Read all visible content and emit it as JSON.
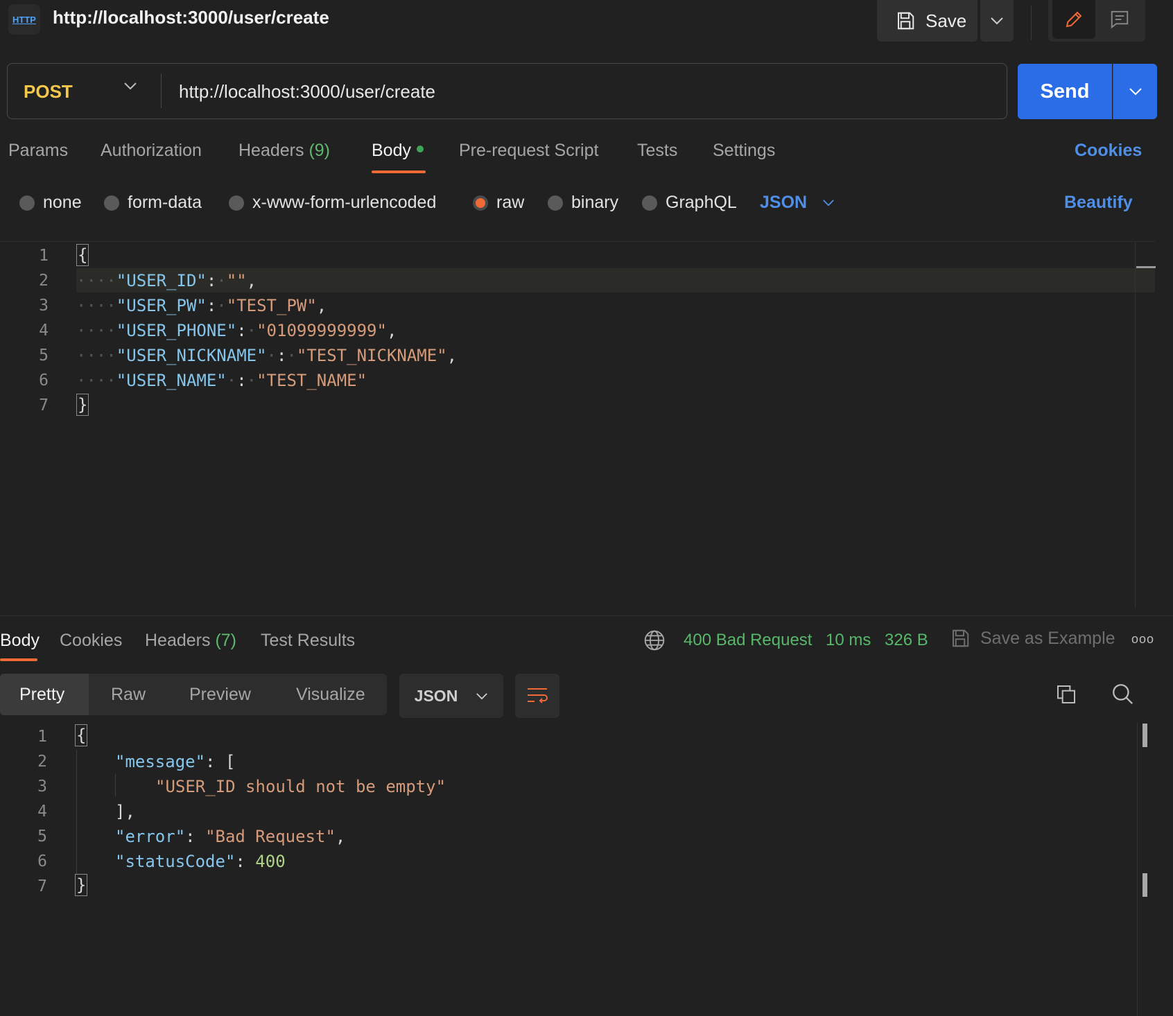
{
  "header": {
    "icon_label": "HTTP",
    "title": "http://localhost:3000/user/create",
    "save_label": "Save"
  },
  "request": {
    "method": "POST",
    "url": "http://localhost:3000/user/create",
    "send_label": "Send"
  },
  "request_tabs": {
    "params": "Params",
    "authorization": "Authorization",
    "headers": "Headers",
    "headers_count": "(9)",
    "body": "Body",
    "pre_request": "Pre-request Script",
    "tests": "Tests",
    "settings": "Settings",
    "cookies": "Cookies"
  },
  "body_types": {
    "none": "none",
    "form_data": "form-data",
    "urlencoded": "x-www-form-urlencoded",
    "raw": "raw",
    "binary": "binary",
    "graphql": "GraphQL",
    "selected_language": "JSON",
    "beautify": "Beautify"
  },
  "request_body": {
    "line_numbers": [
      "1",
      "2",
      "3",
      "4",
      "5",
      "6",
      "7"
    ],
    "open_brace": "{",
    "close_brace": "}",
    "entries": [
      {
        "key": "\"USER_ID\"",
        "sep": ":",
        "value": "\"\"",
        "trail": ","
      },
      {
        "key": "\"USER_PW\"",
        "sep": ":",
        "value": "\"TEST_PW\"",
        "trail": ","
      },
      {
        "key": "\"USER_PHONE\"",
        "sep": ":",
        "value": "\"01099999999\"",
        "trail": ","
      },
      {
        "key": "\"USER_NICKNAME\"",
        "sep": ":",
        "value": "\"TEST_NICKNAME\"",
        "trail": ","
      },
      {
        "key": "\"USER_NAME\"",
        "sep": ":",
        "value": "\"TEST_NAME\"",
        "trail": ""
      }
    ]
  },
  "response_tabs": {
    "body": "Body",
    "cookies": "Cookies",
    "headers": "Headers",
    "headers_count": "(7)",
    "test_results": "Test Results"
  },
  "response_status": {
    "status": "400 Bad Request",
    "time": "10 ms",
    "size": "326 B",
    "save_example": "Save as Example",
    "status_color": "#57b86a"
  },
  "response_format": {
    "pretty": "Pretty",
    "raw": "Raw",
    "preview": "Preview",
    "visualize": "Visualize",
    "language": "JSON"
  },
  "response_body": {
    "line_numbers": [
      "1",
      "2",
      "3",
      "4",
      "5",
      "6",
      "7"
    ],
    "open_brace": "{",
    "close_brace": "}",
    "message_key": "\"message\"",
    "message_open": "[",
    "message_item": "\"USER_ID should not be empty\"",
    "message_close": "],",
    "error_key": "\"error\"",
    "error_value": "\"Bad Request\"",
    "status_key": "\"statusCode\"",
    "status_value": "400"
  },
  "colors": {
    "accent": "#f06a35",
    "send": "#2a6de6",
    "method": "#f3c84b",
    "link": "#4f8fe8"
  }
}
